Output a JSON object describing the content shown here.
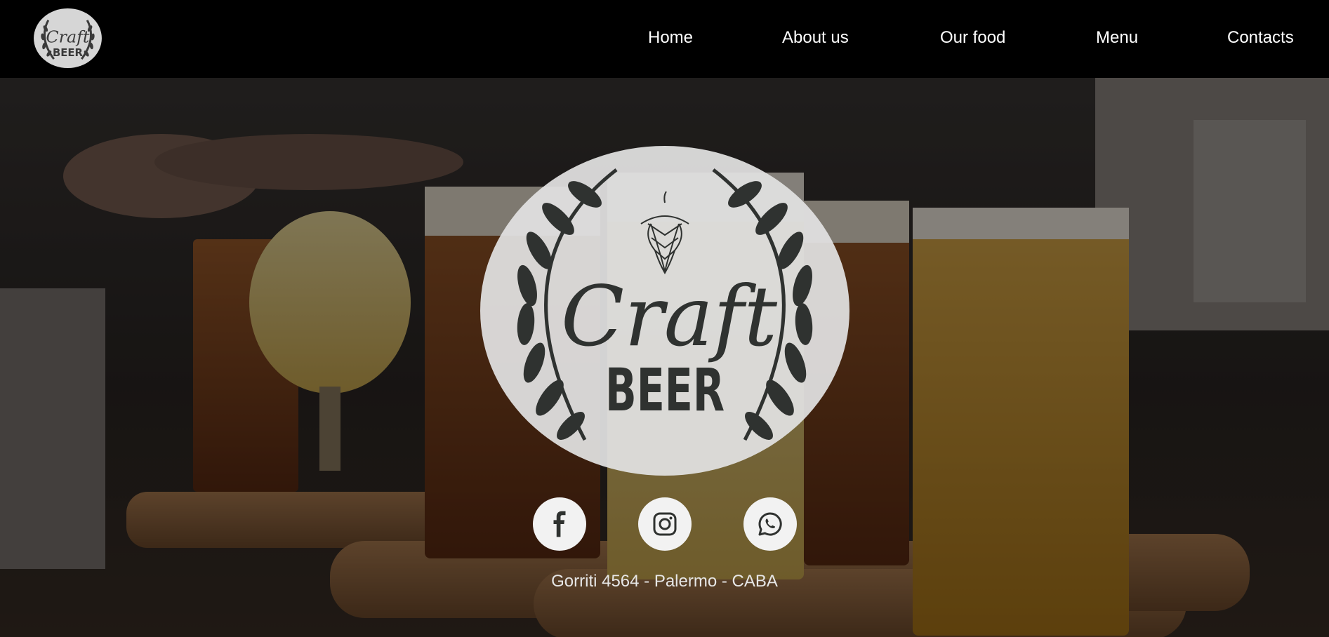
{
  "header": {
    "logo": {
      "line1": "Craft",
      "line2": "BEER",
      "icon": "craft-beer-logo"
    },
    "nav": [
      {
        "label": "Home"
      },
      {
        "label": "About us"
      },
      {
        "label": "Our food"
      },
      {
        "label": "Menu"
      },
      {
        "label": "Contacts"
      }
    ]
  },
  "hero": {
    "background": "photo of beer flight glasses on wooden paddles",
    "logo": {
      "line1": "Craft",
      "line2": "BEER",
      "icon": "hop-cone-icon"
    },
    "social": [
      {
        "icon": "facebook-icon"
      },
      {
        "icon": "instagram-icon"
      },
      {
        "icon": "whatsapp-icon"
      }
    ],
    "address": "Gorriti 4564 - Palermo - CABA"
  },
  "colors": {
    "header_bg": "#000000",
    "logo_badge": "#e0e0e0",
    "logo_ink": "#2f3230",
    "nav_text": "#ffffff"
  }
}
